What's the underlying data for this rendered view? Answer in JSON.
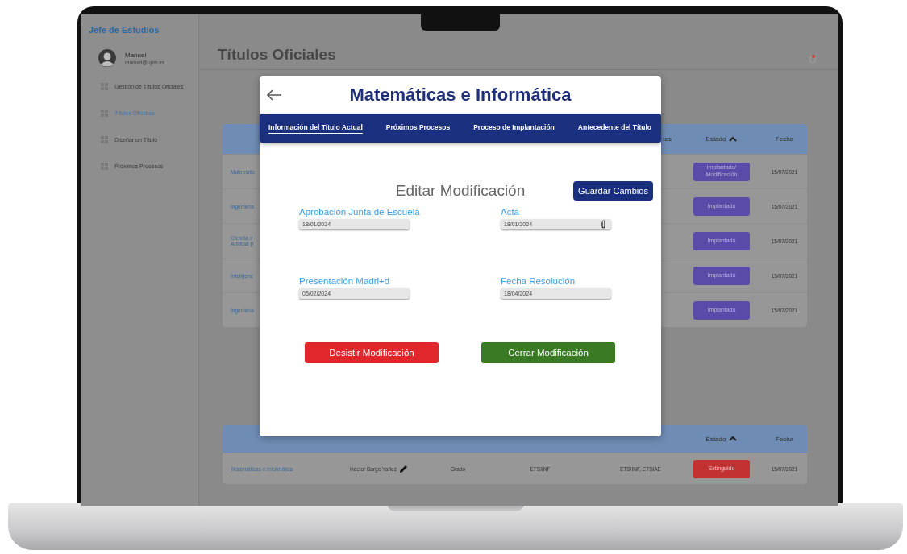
{
  "sidebar": {
    "title": "Jefe de Estudios",
    "user": {
      "name": "Manuel",
      "email": "manuel@upm.es"
    },
    "items": [
      {
        "label": "Gestión de Títulos Oficiales",
        "selected": false
      },
      {
        "label": "Títulos Oficiales",
        "selected": true
      },
      {
        "label": "Diseñar un Título",
        "selected": false
      },
      {
        "label": "Próximos Procesos",
        "selected": false
      }
    ]
  },
  "page": {
    "title": "Títulos Oficiales"
  },
  "table_1": {
    "columns": [
      {
        "label": "tes",
        "sorted": false
      },
      {
        "label": "Estado",
        "sorted": true
      },
      {
        "label": "Fecha",
        "sorted": false
      }
    ],
    "rows": [
      {
        "title": "Matemátic",
        "status": "Implantado/\nModificación",
        "color": "#5b4ba8",
        "date": "15/07/2021"
      },
      {
        "title": "Ingeniería",
        "status": "Implantado",
        "color": "#5b4ba8",
        "date": "15/07/2021"
      },
      {
        "title": "Ciencia d\nArtificial (I",
        "status": "Implantado",
        "color": "#5b4ba8",
        "date": "15/07/2021"
      },
      {
        "title": "Inteligenc",
        "status": "Implantado",
        "color": "#5b4ba8",
        "date": "15/07/2021"
      },
      {
        "title": "Ingeniería",
        "status": "Implantado",
        "color": "#5b4ba8",
        "date": "15/07/2021"
      }
    ]
  },
  "table_2": {
    "columns": [
      {
        "label": "Estado",
        "sorted": true
      },
      {
        "label": "Fecha",
        "sorted": false
      }
    ],
    "rows": [
      {
        "title": "Matemáticas e Informática",
        "coordinator": "Héctor Barge Yañez",
        "type": "Grado",
        "center": "ETSIINF",
        "participants": "ETSIINF, ETSIAE",
        "status": "Extinguido",
        "color": "#c33232",
        "date": "15/07/2021"
      }
    ]
  },
  "modal": {
    "title": "Matemáticas e Informática",
    "tabs": [
      {
        "label": "Información del Título Actual",
        "selected": true
      },
      {
        "label": "Próximos Procesos",
        "selected": false
      },
      {
        "label": "Proceso de Implantación",
        "selected": false
      },
      {
        "label": "Antecedente del Título",
        "selected": false
      }
    ],
    "heading": "Editar Modificación",
    "save_button": "Guardar Cambios",
    "fields": [
      {
        "label": "Aprobación Junta de Escuela",
        "value": "18/01/2024",
        "kind": "date"
      },
      {
        "label": "Acta",
        "value": "18/01/2024",
        "kind": "file"
      },
      {
        "label": "Presentación Madri+d",
        "value": "05/02/2024",
        "kind": "date"
      },
      {
        "label": "Fecha Resolución",
        "value": "18/04/2024",
        "kind": "date"
      }
    ],
    "buttons": [
      {
        "label": "Desistir Modificación",
        "kind": "danger"
      },
      {
        "label": "Cerrar Modificación",
        "kind": "confirm"
      }
    ]
  }
}
